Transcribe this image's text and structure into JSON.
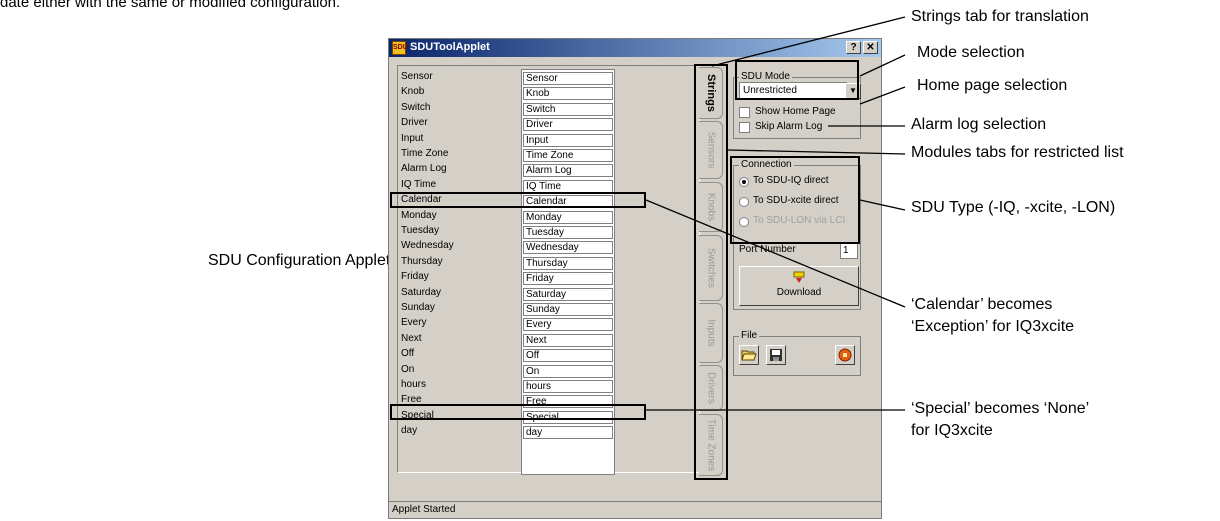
{
  "intro_text": "date either with the same or modified configuration.",
  "side_caption": "SDU Configuration Applet Display",
  "window": {
    "title": "SDUToolApplet",
    "icon_label": "SDU",
    "help_button": "?",
    "close_button": "✕",
    "status": "Applet Started"
  },
  "strings_rows": [
    {
      "label": "Sensor",
      "value": "Sensor"
    },
    {
      "label": "Knob",
      "value": "Knob"
    },
    {
      "label": "Switch",
      "value": "Switch"
    },
    {
      "label": "Driver",
      "value": "Driver"
    },
    {
      "label": "Input",
      "value": "Input"
    },
    {
      "label": "Time Zone",
      "value": "Time Zone"
    },
    {
      "label": "Alarm Log",
      "value": "Alarm Log"
    },
    {
      "label": "IQ Time",
      "value": "IQ Time"
    },
    {
      "label": "Calendar",
      "value": "Calendar"
    },
    {
      "label": "Monday",
      "value": "Monday"
    },
    {
      "label": "Tuesday",
      "value": "Tuesday"
    },
    {
      "label": "Wednesday",
      "value": "Wednesday"
    },
    {
      "label": "Thursday",
      "value": "Thursday"
    },
    {
      "label": "Friday",
      "value": "Friday"
    },
    {
      "label": "Saturday",
      "value": "Saturday"
    },
    {
      "label": "Sunday",
      "value": "Sunday"
    },
    {
      "label": "Every",
      "value": "Every"
    },
    {
      "label": "Next",
      "value": "Next"
    },
    {
      "label": "Off",
      "value": "Off"
    },
    {
      "label": "On",
      "value": "On"
    },
    {
      "label": "hours",
      "value": "hours"
    },
    {
      "label": "Free",
      "value": "Free"
    },
    {
      "label": "Special",
      "value": "Special"
    },
    {
      "label": "day",
      "value": "day"
    }
  ],
  "tabs": [
    "Strings",
    "Sensors",
    "Knobs",
    "Switches",
    "Inputs",
    "Drivers",
    "Time Zones"
  ],
  "active_tab": "Strings",
  "sdu_mode": {
    "title": "SDU Mode",
    "selected": "Unrestricted",
    "show_home_page": "Show Home Page",
    "show_home_page_checked": false,
    "skip_alarm_log": "Skip Alarm Log",
    "skip_alarm_log_checked": false
  },
  "connection": {
    "title": "Connection",
    "options": [
      {
        "label": "To SDU-IQ direct",
        "selected": true,
        "enabled": true
      },
      {
        "label": "To SDU-xcite direct",
        "selected": false,
        "enabled": true
      },
      {
        "label": "To SDU-LON via LCI",
        "selected": false,
        "enabled": false
      }
    ],
    "port_label": "Port Number",
    "port_value": "1",
    "download_label": "Download"
  },
  "file": {
    "title": "File",
    "open_icon": "folder-open-icon",
    "save_icon": "floppy-disk-icon",
    "stop_icon": "stop-icon"
  },
  "callouts": {
    "strings_tab": "Strings tab for translation",
    "mode": "Mode selection",
    "home_page": "Home page selection",
    "alarm_log": "Alarm log selection",
    "modules_tabs": "Modules tabs for restricted list",
    "sdu_type": "SDU Type (-IQ, -xcite, -LON)",
    "calendar_line1": "‘Calendar’   becomes",
    "calendar_line2": "‘Exception’ for IQ3xcite",
    "special_line1": "‘Special’ becomes ‘None’",
    "special_line2": "for IQ3xcite"
  }
}
